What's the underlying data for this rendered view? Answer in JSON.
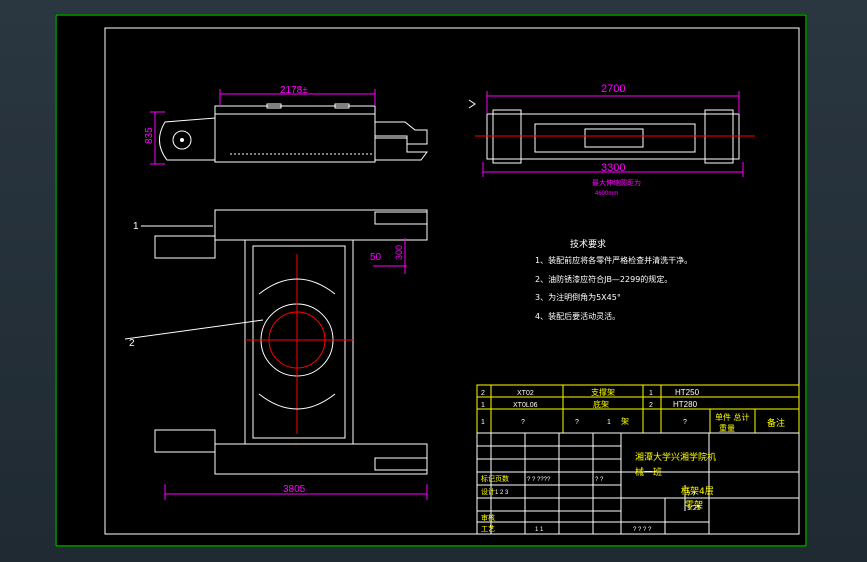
{
  "drawing": {
    "dimensions": {
      "top_left_width": "2178±",
      "top_left_height": "835",
      "top_right_width": "2700",
      "top_right_total": "3300",
      "top_right_note": "最大伸缩圆距为",
      "top_right_note2": "4600mm",
      "plan_gap": "50",
      "plan_side": "300",
      "plan_total": "3805"
    },
    "callouts": [
      "1",
      "2"
    ],
    "tech_requirements": {
      "title": "技术要求",
      "items": [
        "1、装配前应将各零件严格检查并清洗干净。",
        "2、油防锈漆应符合JB—2299的规定。",
        "3、为注明倒角为5X45°",
        "4、装配后要活动灵活。"
      ]
    },
    "parts_list": [
      {
        "no": "2",
        "code": "XT02",
        "name": "支撑架",
        "qty": "1",
        "material": "HT250"
      },
      {
        "no": "1",
        "code": "XT0L06",
        "name": "底架",
        "qty": "2",
        "material": "HT280"
      }
    ],
    "parts_header": {
      "no": "1",
      "code": "?",
      "name": "?",
      "qty": "1",
      "mark": "架",
      "material": "?",
      "weight_label": "单件 总计",
      "weight_sub": "重量",
      "remark": "备注"
    },
    "title_block": {
      "school": "湘潭大学兴湘学院机",
      "school2": "械一班",
      "drawing_name": "框架4层",
      "drawing_name2": "零架",
      "scale": "1:25",
      "rows": {
        "mark": "标记",
        "design": "设计",
        "review": "审核",
        "craft": "工艺"
      },
      "row_values": {
        "mark_cell": "页数",
        "design_date": "1 2 3",
        "qs1": "?   ?   ????",
        "qs2": "? ?",
        "craft_val": "1 1",
        "page": "? ?",
        "misc": "? ? ? ?"
      }
    }
  }
}
